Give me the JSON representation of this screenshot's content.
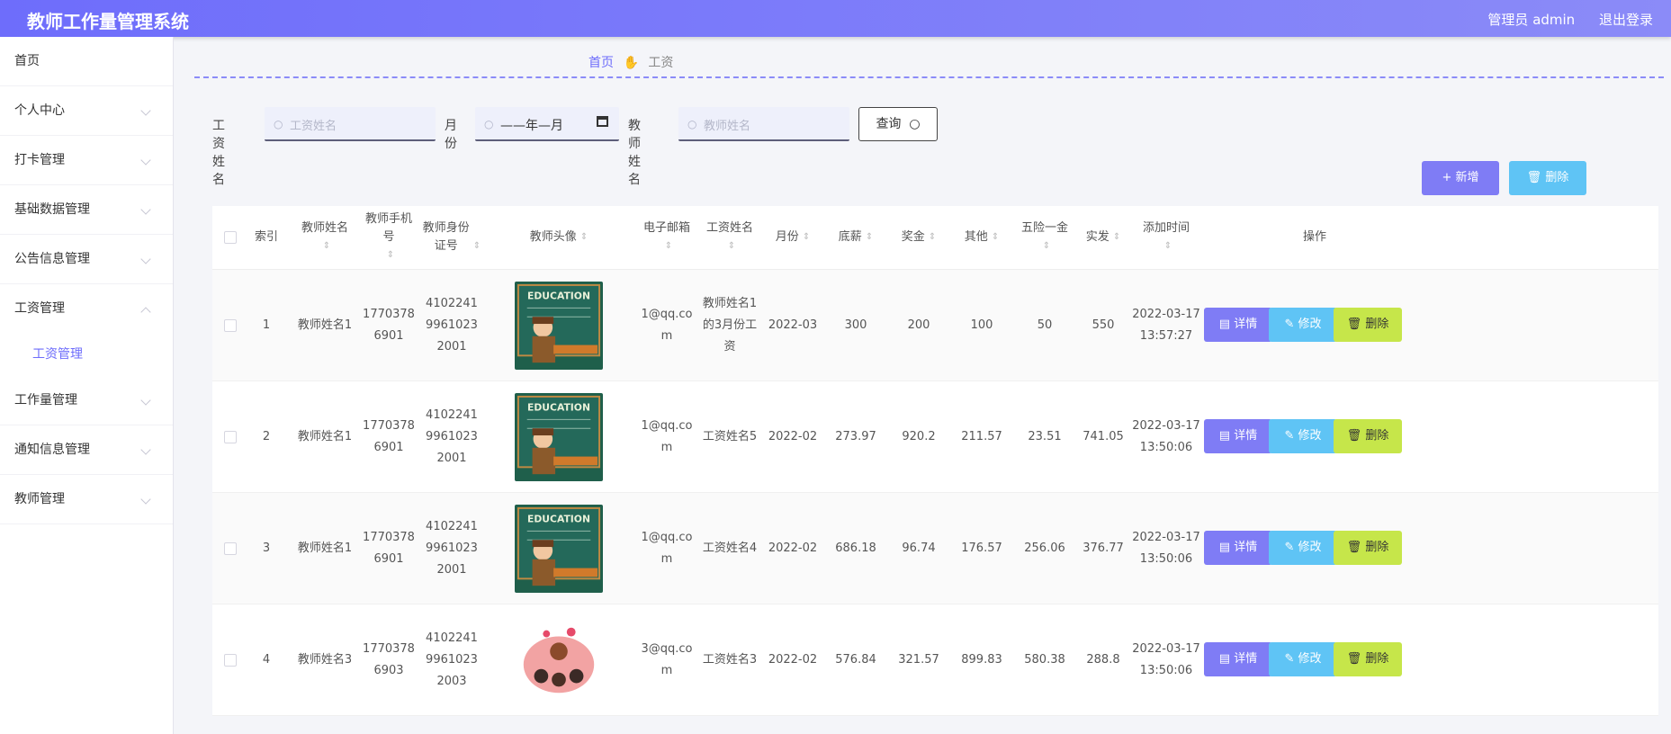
{
  "header": {
    "title": "教师工作量管理系统",
    "user": "管理员 admin",
    "logout": "退出登录"
  },
  "sidebar": {
    "items": [
      {
        "label": "首页"
      },
      {
        "label": "个人中心"
      },
      {
        "label": "打卡管理"
      },
      {
        "label": "基础数据管理"
      },
      {
        "label": "公告信息管理"
      },
      {
        "label": "工资管理"
      },
      {
        "label": "工作量管理"
      },
      {
        "label": "通知信息管理"
      },
      {
        "label": "教师管理"
      }
    ],
    "sub_item": "工资管理"
  },
  "breadcrumb": {
    "home": "首页",
    "current": "工资"
  },
  "search": {
    "salary_name_label": "工资姓名",
    "salary_name_placeholder": "工资姓名",
    "month_label": "月份",
    "month_value": "——年—月",
    "teacher_name_label": "教师姓名",
    "teacher_name_placeholder": "教师姓名",
    "query_button": "查询"
  },
  "actions": {
    "add": "+ 新增",
    "delete": "删除"
  },
  "table": {
    "headers": {
      "index": "索引",
      "name": "教师姓名",
      "phone": "教师手机号",
      "idcard": "教师身份证号",
      "avatar": "教师头像",
      "email": "电子邮箱",
      "salary_name": "工资姓名",
      "month": "月份",
      "base": "底薪",
      "bonus": "奖金",
      "other": "其他",
      "insurance": "五险一金",
      "net": "实发",
      "added": "添加时间",
      "ops": "操作"
    },
    "rows": [
      {
        "index": "1",
        "name": "教师姓名1",
        "phone": "17703786901",
        "idcard": "410224199610232001",
        "email": "1@qq.com",
        "salary_name": "教师姓名1的3月份工资",
        "month": "2022-03",
        "base": "300",
        "bonus": "200",
        "other": "100",
        "insurance": "50",
        "net": "550",
        "added": "2022-03-17 13:57:27",
        "avatar": "education-chalkboard"
      },
      {
        "index": "2",
        "name": "教师姓名1",
        "phone": "17703786901",
        "idcard": "410224199610232001",
        "email": "1@qq.com",
        "salary_name": "工资姓名5",
        "month": "2022-02",
        "base": "273.97",
        "bonus": "920.2",
        "other": "211.57",
        "insurance": "23.51",
        "net": "741.05",
        "added": "2022-03-17 13:50:06",
        "avatar": "education-chalkboard"
      },
      {
        "index": "3",
        "name": "教师姓名1",
        "phone": "17703786901",
        "idcard": "410224199610232001",
        "email": "1@qq.com",
        "salary_name": "工资姓名4",
        "month": "2022-02",
        "base": "686.18",
        "bonus": "96.74",
        "other": "176.57",
        "insurance": "256.06",
        "net": "376.77",
        "added": "2022-03-17 13:50:06",
        "avatar": "education-chalkboard"
      },
      {
        "index": "4",
        "name": "教师姓名3",
        "phone": "17703786903",
        "idcard": "410224199610232003",
        "email": "3@qq.com",
        "salary_name": "工资姓名3",
        "month": "2022-02",
        "base": "576.84",
        "bonus": "321.57",
        "other": "899.83",
        "insurance": "580.38",
        "net": "288.8",
        "added": "2022-03-17 13:50:06",
        "avatar": "teacher-with-kids"
      }
    ],
    "row_buttons": {
      "detail": "详情",
      "edit": "修改",
      "delete": "删除"
    },
    "avatar_caption": "EDUCATION"
  },
  "colors": {
    "primary": "#6e6dfb",
    "edit": "#5fc4f5",
    "delete": "#c6e64a"
  }
}
